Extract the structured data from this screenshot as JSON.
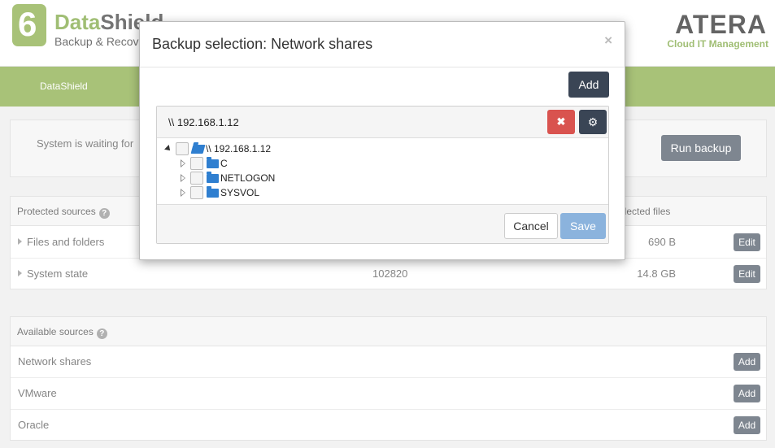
{
  "header": {
    "brand_a": "Data",
    "brand_b": "Shield",
    "logo_digit": "6",
    "subtitle": "Backup & Recovery",
    "vendor": "ATERA",
    "vendor_sub": "Cloud IT Management"
  },
  "nav": {
    "item": "DataShield"
  },
  "status": {
    "text": "System is waiting for",
    "run_button": "Run backup"
  },
  "protected": {
    "title": "Protected sources",
    "col_selected": "Selected files",
    "rows": [
      {
        "name": "Files and folders",
        "mid": "",
        "size": "690 B",
        "button": "Edit"
      },
      {
        "name": "System state",
        "mid": "102820",
        "size": "14.8 GB",
        "button": "Edit"
      }
    ]
  },
  "available": {
    "title": "Available sources",
    "rows": [
      {
        "name": "Network shares",
        "button": "Add"
      },
      {
        "name": "VMware",
        "button": "Add"
      },
      {
        "name": "Oracle",
        "button": "Add"
      }
    ]
  },
  "modal": {
    "title": "Backup selection: Network shares",
    "close": "×",
    "add_button": "Add",
    "share": {
      "title": "\\\\ 192.168.1.12",
      "delete_icon": "✖",
      "gear_icon": "⚙",
      "tree": {
        "root": "\\\\ 192.168.1.12",
        "children": [
          "C",
          "NETLOGON",
          "SYSVOL"
        ]
      },
      "cancel": "Cancel",
      "save": "Save"
    }
  },
  "colors": {
    "brand_green": "#7aa231",
    "dark_button": "#3a4555",
    "danger": "#d9534f",
    "folder_blue": "#2f7fd0",
    "save_disabled": "#8bb3dd"
  }
}
